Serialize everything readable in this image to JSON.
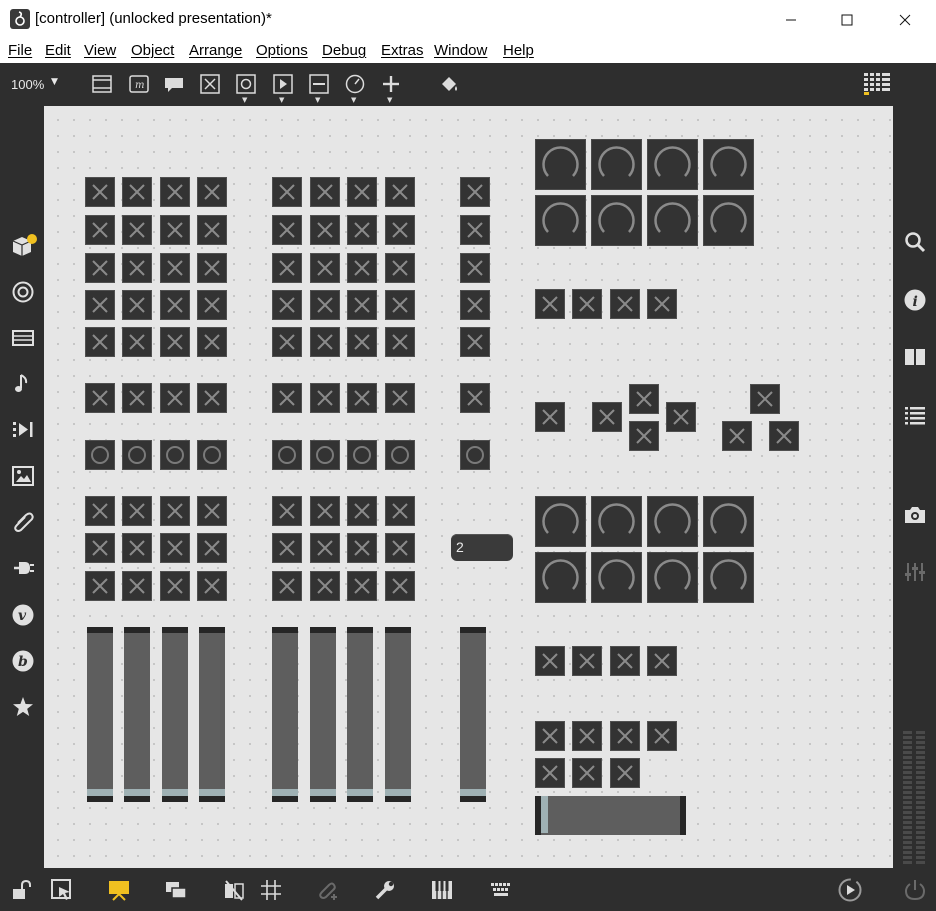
{
  "window": {
    "title": "[controller] (unlocked presentation)*",
    "app_icon_glyph": "Ἲ",
    "minimize_glyph": "—",
    "maximize_glyph": "☐",
    "close_glyph": "✕"
  },
  "menu": [
    "File",
    "Edit",
    "View",
    "Object",
    "Arrange",
    "Options",
    "Debug",
    "Extras",
    "Window",
    "Help"
  ],
  "toolbar": {
    "zoom": "100%",
    "zoom_caret": "▼",
    "icons": [
      "new-object-icon",
      "message-icon",
      "comment-icon",
      "toggle-icon",
      "button-icon",
      "playbar-icon",
      "slider-icon",
      "dial-icon",
      "plus-icon",
      "paint-bucket-icon",
      "grid-panel-icon"
    ]
  },
  "left_sidebar": [
    "package-icon",
    "target-icon",
    "media-icon",
    "music-note-icon",
    "clip-icon",
    "image-icon",
    "paperclip-icon",
    "plug-icon",
    "v-badge-icon",
    "b-badge-icon",
    "star-icon"
  ],
  "right_sidebar": [
    "search-icon",
    "info-icon",
    "book-icon",
    "list-icon",
    "camera-icon",
    "mixer-icon"
  ],
  "bottom_bar": [
    "lock-icon",
    "presentation-select-icon",
    "presentation-mode-icon",
    "layers-icon",
    "hide-icon",
    "grid-icon",
    "attach-icon",
    "wrench-icon",
    "piano-icon",
    "keyboard-icon",
    "transport-icon",
    "power-icon"
  ],
  "canvas": {
    "number_box_value": "2"
  },
  "colors": {
    "accent_yellow": "#f0c020",
    "canvas_bg": "#e6e6e6",
    "cell_bg": "#333333",
    "slider_thumb": "#9fb1b4"
  }
}
